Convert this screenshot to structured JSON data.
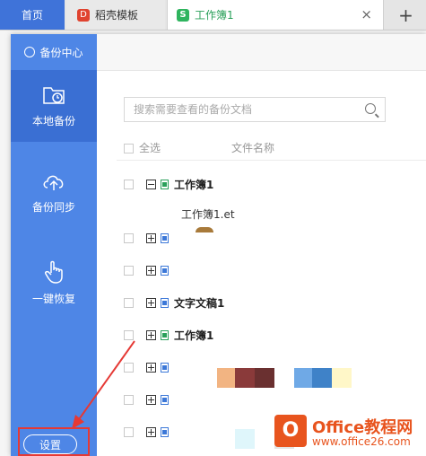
{
  "tabs": {
    "home": "首页",
    "docer": "稻壳模板",
    "doc": "工作簿1",
    "close": "×",
    "add": "+"
  },
  "sidebar": {
    "title": "备份中心",
    "items": [
      {
        "label": "本地备份",
        "icon": "folder-clock-icon",
        "active": true
      },
      {
        "label": "备份同步",
        "icon": "cloud-upload-icon",
        "active": false
      },
      {
        "label": "一键恢复",
        "icon": "hand-pointer-icon",
        "active": false
      }
    ],
    "settings_label": "设置"
  },
  "search": {
    "placeholder": "搜索需要查看的备份文档"
  },
  "list": {
    "select_all": "全选",
    "col_filename": "文件名称",
    "rows": [
      {
        "name": "工作簿1",
        "expanded": true,
        "icon": "green"
      },
      {
        "name": "",
        "expanded": false,
        "icon": "blue"
      },
      {
        "name": "",
        "expanded": false,
        "icon": "blue"
      },
      {
        "name": "文字文稿1",
        "expanded": false,
        "icon": "blue"
      },
      {
        "name": "工作簿1",
        "expanded": false,
        "icon": "green"
      },
      {
        "name": "",
        "expanded": false,
        "icon": "blue"
      },
      {
        "name": "",
        "expanded": false,
        "icon": "blue"
      },
      {
        "name": "",
        "expanded": false,
        "icon": "blue"
      }
    ],
    "tooltip": "工作簿1.et"
  },
  "watermark": {
    "title": "Office教程网",
    "url": "www.office26.com",
    "logo_char": "O"
  },
  "colors": {
    "sidebar": "#4e86e6",
    "sidebar_active": "#3a6fd3",
    "tab_home": "#3f73d9",
    "highlight": "#e53935"
  }
}
